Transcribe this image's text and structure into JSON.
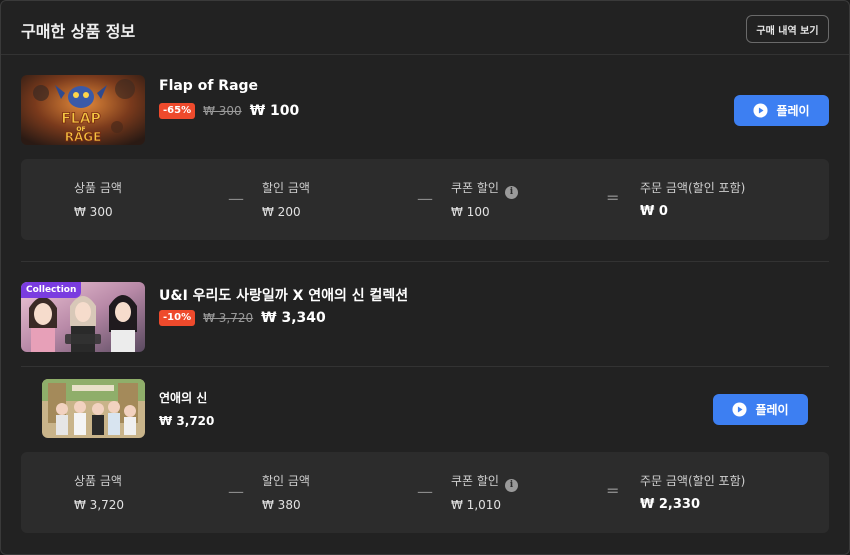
{
  "header": {
    "title": "구매한 상품 정보",
    "history_button": "구매 내역 보기"
  },
  "products": [
    {
      "title": "Flap of Rage",
      "thumb_text_1": "FLAP",
      "thumb_text_2": "RAGE",
      "thumb_text_of": "OF",
      "discount": "-65%",
      "original_price": "₩ 300",
      "final_price": "₩ 100",
      "play_label": "플레이",
      "summary": {
        "product_amount_label": "상품 금액",
        "product_amount": "₩ 300",
        "minus1": "—",
        "discount_label": "할인 금액",
        "discount_amount": "₩ 200",
        "minus2": "—",
        "coupon_label": "쿠폰 할인",
        "coupon_amount": "₩ 100",
        "equals": "=",
        "order_label": "주문 금액(할인 포함)",
        "order_amount": "₩ 0"
      }
    },
    {
      "title": "U&I 우리도 사랑일까 X 연애의 신 컬렉션",
      "collection_badge": "Collection",
      "discount": "-10%",
      "original_price": "₩ 3,720",
      "final_price": "₩ 3,340",
      "sub_item": {
        "title": "연애의 신",
        "price": "₩ 3,720",
        "play_label": "플레이"
      },
      "summary": {
        "product_amount_label": "상품 금액",
        "product_amount": "₩ 3,720",
        "minus1": "—",
        "discount_label": "할인 금액",
        "discount_amount": "₩ 380",
        "minus2": "—",
        "coupon_label": "쿠폰 할인",
        "coupon_amount": "₩ 1,010",
        "equals": "=",
        "order_label": "주문 금액(할인 포함)",
        "order_amount": "₩ 2,330"
      }
    }
  ],
  "icons": {
    "play": "play-icon",
    "info": "info-icon"
  },
  "colors": {
    "accent": "#3d7ff2",
    "discount_badge": "#ee4a2c",
    "collection_badge": "#7a3ce0",
    "background": "#222222",
    "card": "#2c2c2c"
  }
}
